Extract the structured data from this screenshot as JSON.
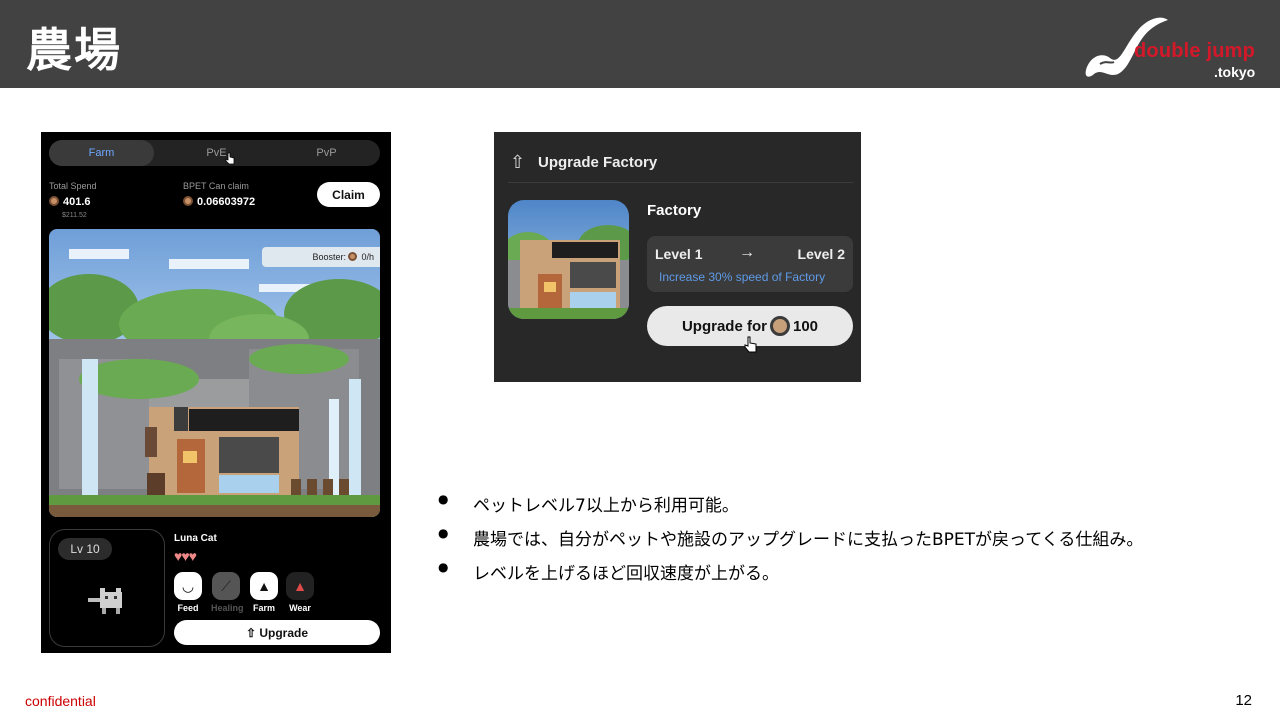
{
  "slide": {
    "title": "農場",
    "logo_text": "double jump",
    "logo_sub": ".tokyo",
    "footer_confidential": "confidential",
    "page_number": "12"
  },
  "app": {
    "tabs": [
      "Farm",
      "PvE",
      "PvP"
    ],
    "active_tab": "Farm",
    "total_spend_label": "Total Spend",
    "total_spend_value": "401.6",
    "total_spend_usd": "$211.52",
    "bpet_label": "BPET Can claim",
    "bpet_value": "0.06603972",
    "claim_label": "Claim",
    "booster_label": "Booster:",
    "booster_value": "0/h",
    "pet": {
      "level": "Lv 10",
      "name": "Luna Cat",
      "hearts": "♥♥♥",
      "actions": [
        {
          "label": "Feed",
          "icon": "bowl-icon",
          "enabled": true
        },
        {
          "label": "Healing",
          "icon": "bandage-icon",
          "enabled": false
        },
        {
          "label": "Farm",
          "icon": "tree-icon",
          "enabled": true
        },
        {
          "label": "Wear",
          "icon": "hat-icon",
          "enabled": true
        }
      ],
      "upgrade_label": "Upgrade"
    }
  },
  "dialog": {
    "title": "Upgrade Factory",
    "item_name": "Factory",
    "level_from": "Level 1",
    "level_to": "Level 2",
    "description": "Increase 30% speed of Factory",
    "upgrade_prefix": "Upgrade for",
    "upgrade_cost": "100"
  },
  "bullets": [
    "ペットレベル7以上から利用可能。",
    "農場では、自分がペットや施設のアップグレードに支払ったBPETが戻ってくる仕組み。",
    "レベルを上げるほど回収速度が上がる。"
  ],
  "colors": {
    "header_bg": "#424242",
    "brand_red": "#d3182a",
    "active_tab": "#6ea8ff",
    "level_desc": "#5e9be8"
  }
}
